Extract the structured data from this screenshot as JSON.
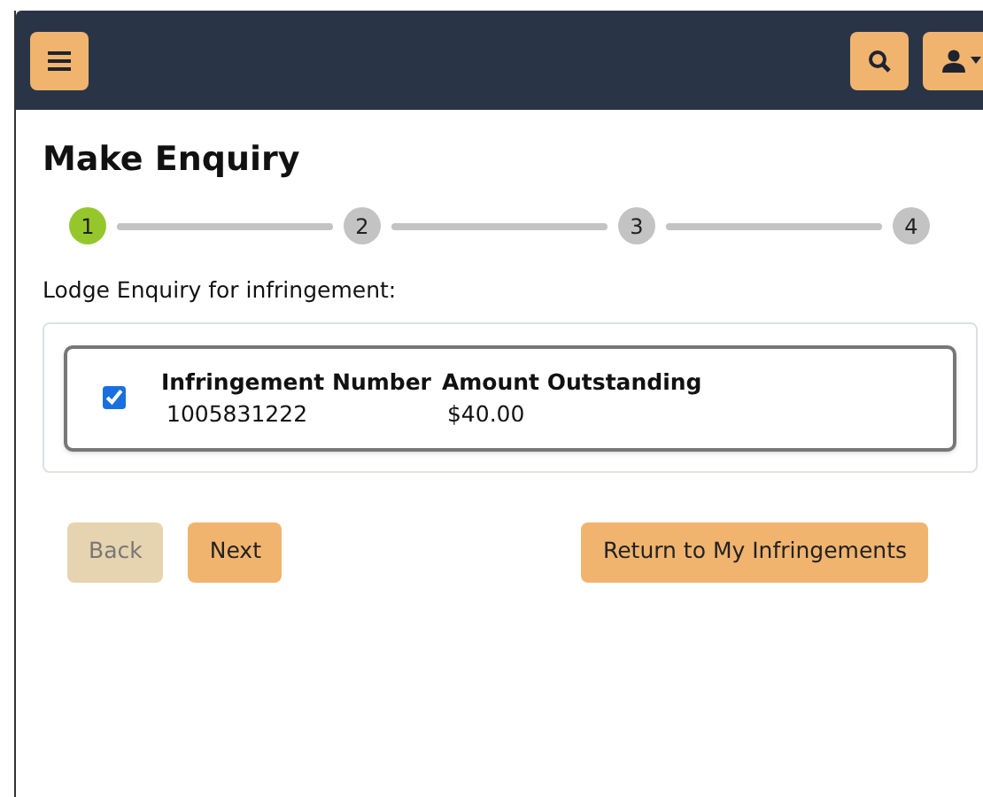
{
  "title": "Make Enquiry",
  "steps": [
    {
      "label": "1",
      "selected": true
    },
    {
      "label": "2",
      "selected": false
    },
    {
      "label": "3",
      "selected": false
    },
    {
      "label": "4",
      "selected": false
    }
  ],
  "prompt": "Lodge Enquiry for infringement:",
  "infringements": [
    {
      "checked": true,
      "columns": [
        {
          "heading": "Infringement Number",
          "value": "1005831222"
        },
        {
          "heading": "Amount Outstanding",
          "value": "$40.00"
        }
      ]
    }
  ],
  "buttons": [
    {
      "label": "Back",
      "disabled": true
    },
    {
      "label": "Next",
      "disabled": false
    },
    {
      "label": "Return to My Infringements",
      "disabled": false
    }
  ]
}
